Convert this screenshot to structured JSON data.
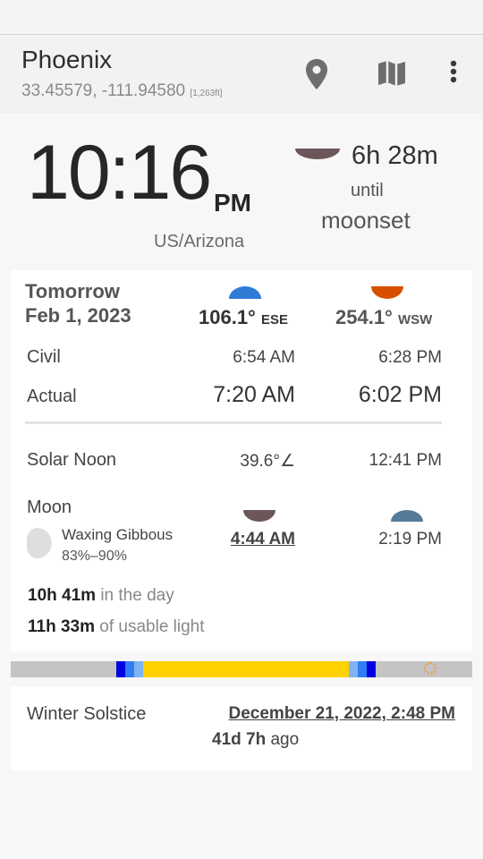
{
  "location": {
    "name": "Phoenix",
    "coordinates": "33.45579, -111.94580",
    "elevation": "[1,263ft]"
  },
  "icons": {
    "pin": "map-pin-icon",
    "map": "map-icon",
    "more": "more-vert-icon"
  },
  "clock": {
    "time": "10:16",
    "ampm": "PM",
    "timezone": "US/Arizona"
  },
  "countdown": {
    "duration": "6h 28m",
    "until": "until",
    "event": "moonset"
  },
  "day": {
    "label": "Tomorrow",
    "date": "Feb 1, 2023",
    "sunrise_azimuth": "106.1°",
    "sunrise_direction": "ESE",
    "sunset_azimuth": "254.1°",
    "sunset_direction": "WSW",
    "rows": {
      "civil": {
        "label": "Civil",
        "rise": "6:54 AM",
        "set": "6:28 PM"
      },
      "actual": {
        "label": "Actual",
        "rise": "7:20 AM",
        "set": "6:02 PM"
      },
      "noon": {
        "label": "Solar Noon",
        "altitude": "39.6°∠",
        "time": "12:41 PM"
      }
    },
    "moon": {
      "label": "Moon",
      "phase": "Waxing Gibbous",
      "illumination": "83%–90%",
      "rise": "4:44 AM",
      "set": "2:19 PM"
    },
    "day_length": {
      "value": "10h 41m",
      "text": "in the day"
    },
    "usable_light": {
      "value": "11h 33m",
      "text": "of usable light"
    }
  },
  "colors": {
    "night": "#c4c4c4",
    "astro_twilight": "#0000e0",
    "nautical_twilight": "#2f7ef4",
    "civil_twilight": "#7fb2f0",
    "daylight": "#ffd100",
    "sunrise_icon": "#2e7cd6",
    "sunset_icon": "#d94f00",
    "moon_up_icon": "#6c5659",
    "moon_down_icon": "#567b99",
    "now_marker": "#f0a030"
  },
  "solstice": {
    "label": "Winter Solstice",
    "date": "December 21, 2022, 2:48 PM",
    "ago_value": "41d 7h",
    "ago_text": "ago"
  }
}
